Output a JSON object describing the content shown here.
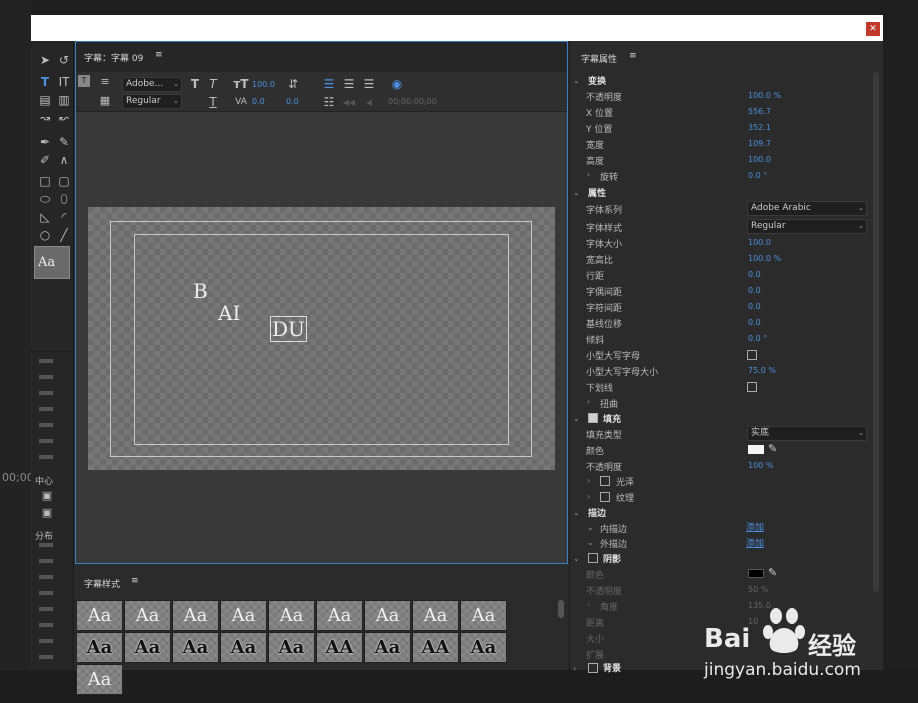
{
  "main_panel": {
    "title": "字幕：字幕 09",
    "menu_icon": "menu-icon"
  },
  "toolbar": {
    "font_family": "Adobe...",
    "font_style": "Regular",
    "font_size": "100.0",
    "kerning": "0.0",
    "leading": "0.0",
    "timecode": "00;00;00;00"
  },
  "canvas": {
    "text_b": "B",
    "text_ai": "AI",
    "text_du": "DU"
  },
  "styles_panel": {
    "title": "字幕样式",
    "swatches": [
      "Aa",
      "Aa",
      "Aa",
      "Aa",
      "Aa",
      "Aa",
      "Aa",
      "Aa",
      "Aa",
      "Aa",
      "Aa",
      "Aa",
      "Aa",
      "Aa",
      "AA",
      "Aa",
      "AA",
      "Aa",
      "Aa"
    ]
  },
  "props": {
    "title": "字幕属性",
    "transform": {
      "label": "变换",
      "opacity_label": "不透明度",
      "opacity": "100.0 %",
      "x_label": "X 位置",
      "x": "556.7",
      "y_label": "Y 位置",
      "y": "352.1",
      "width_label": "宽度",
      "width": "109.7",
      "height_label": "高度",
      "height": "100.0",
      "rotation_label": "旋转",
      "rotation": "0.0 °"
    },
    "attributes": {
      "label": "属性",
      "font_family_label": "字体系列",
      "font_family": "Adobe Arabic",
      "font_style_label": "字体样式",
      "font_style": "Regular",
      "font_size_label": "字体大小",
      "font_size": "100.0",
      "aspect_label": "宽高比",
      "aspect": "100.0 %",
      "leading_label": "行距",
      "leading": "0.0",
      "kerning_label": "字偶间距",
      "kerning": "0.0",
      "tracking_label": "字符间距",
      "tracking": "0.0",
      "baseline_label": "基线位移",
      "baseline": "0.0",
      "slant_label": "倾斜",
      "slant": "0.0 °",
      "small_caps_label": "小型大写字母",
      "small_caps_size_label": "小型大写字母大小",
      "small_caps_size": "75.0 %",
      "underline_label": "下划线",
      "distort_label": "扭曲"
    },
    "fill": {
      "label": "填充",
      "type_label": "填充类型",
      "type": "实底",
      "color_label": "颜色",
      "opacity_label": "不透明度",
      "opacity": "100 %",
      "sheen_label": "光泽",
      "texture_label": "纹理"
    },
    "stroke": {
      "label": "描边",
      "inner_label": "内描边",
      "inner_add": "添加",
      "outer_label": "外描边",
      "outer_add": "添加"
    },
    "shadow": {
      "label": "阴影",
      "color_label": "颜色",
      "opacity_label": "不透明度",
      "opacity": "50 %",
      "angle_label": "角度",
      "angle": "135.0",
      "distance_label": "距离",
      "distance": "10",
      "size_label": "大小",
      "spread_label": "扩展"
    },
    "background": {
      "label": "背景"
    }
  },
  "toolbox": {
    "center_label": "中心",
    "distribute_label": "分布",
    "preview": "Aa"
  },
  "left_edge": {
    "timecode": "00;00"
  },
  "watermark": {
    "brand": "Bai",
    "brand2": "经验",
    "url": "jingyan.baidu.com"
  }
}
